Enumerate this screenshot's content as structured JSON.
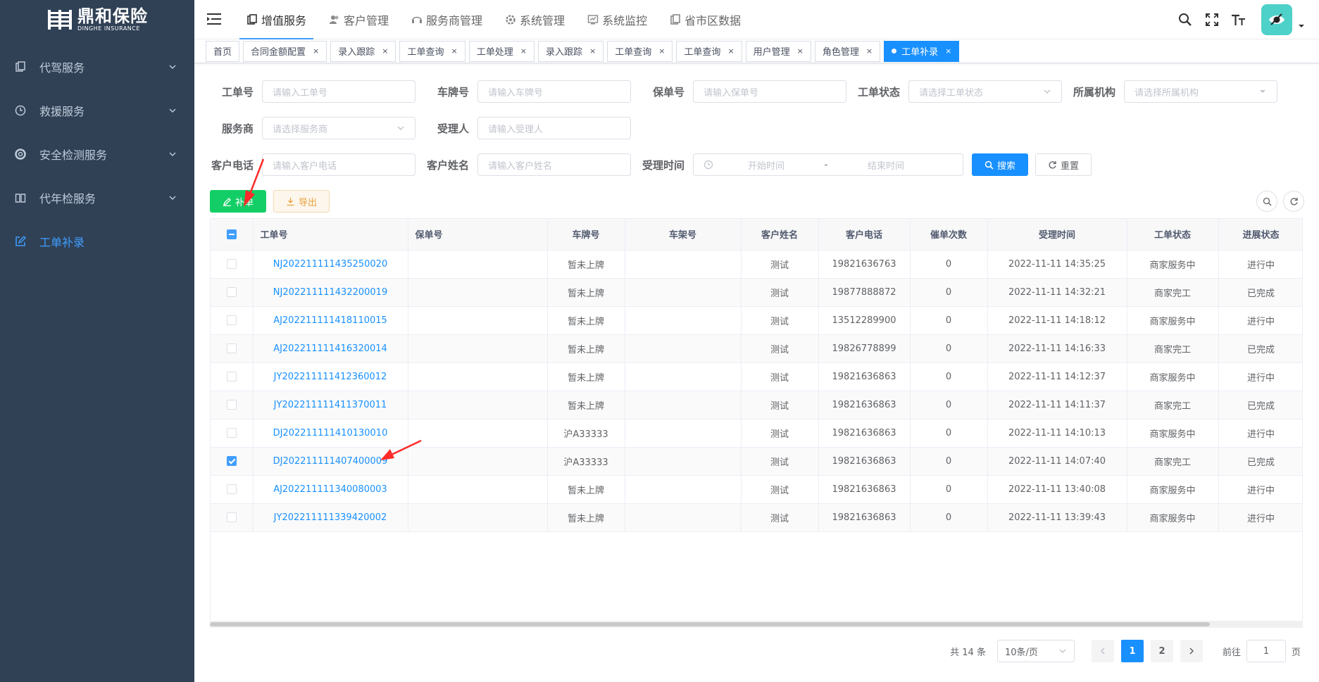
{
  "sidebar": {
    "logo_cn": "鼎和保险",
    "logo_en": "DINGHE INSURANCE",
    "items": [
      {
        "label": "代驾服务"
      },
      {
        "label": "救援服务"
      },
      {
        "label": "安全检测服务"
      },
      {
        "label": "代年检服务"
      },
      {
        "label": "工单补录"
      }
    ]
  },
  "topnav": {
    "items": [
      {
        "label": "增值服务"
      },
      {
        "label": "客户管理"
      },
      {
        "label": "服务商管理"
      },
      {
        "label": "系统管理"
      },
      {
        "label": "系统监控"
      },
      {
        "label": "省市区数据"
      }
    ]
  },
  "tags": [
    {
      "label": "首页"
    },
    {
      "label": "合同金额配置"
    },
    {
      "label": "录入跟踪"
    },
    {
      "label": "工单查询"
    },
    {
      "label": "工单处理"
    },
    {
      "label": "录入跟踪"
    },
    {
      "label": "工单查询"
    },
    {
      "label": "工单查询"
    },
    {
      "label": "用户管理"
    },
    {
      "label": "角色管理"
    },
    {
      "label": "工单补录"
    }
  ],
  "tag_close": "×",
  "form": {
    "order_no": {
      "label": "工单号",
      "placeholder": "请输入工单号"
    },
    "plate": {
      "label": "车牌号",
      "placeholder": "请输入车牌号"
    },
    "policy": {
      "label": "保单号",
      "placeholder": "请输入保单号"
    },
    "status": {
      "label": "工单状态",
      "placeholder": "请选择工单状态"
    },
    "org": {
      "label": "所属机构",
      "placeholder": "请选择所属机构"
    },
    "provider": {
      "label": "服务商",
      "placeholder": "请选择服务商"
    },
    "acceptor": {
      "label": "受理人",
      "placeholder": "请输入受理人"
    },
    "phone": {
      "label": "客户电话",
      "placeholder": "请输入客户电话"
    },
    "name": {
      "label": "客户姓名",
      "placeholder": "请输入客户姓名"
    },
    "time": {
      "label": "受理时间",
      "start": "开始时间",
      "sep": "-",
      "end": "结束时间"
    },
    "search_btn": "搜索",
    "reset_btn": "重置"
  },
  "toolbar": {
    "add_btn": "补单",
    "export_btn": "导出"
  },
  "table": {
    "headers": [
      "工单号",
      "保单号",
      "车牌号",
      "车架号",
      "客户姓名",
      "客户电话",
      "催单次数",
      "受理时间",
      "工单状态",
      "进展状态"
    ],
    "rows": [
      {
        "order": "NJ202211111435250020",
        "policy": "",
        "plate": "暂未上牌",
        "vin": "",
        "name": "测试",
        "phone": "19821636763",
        "urge": "0",
        "time": "2022-11-11 14:35:25",
        "status": "商家服务中",
        "progress": "进行中",
        "checked": false
      },
      {
        "order": "NJ202211111432200019",
        "policy": "",
        "plate": "暂未上牌",
        "vin": "",
        "name": "测试",
        "phone": "19877888872",
        "urge": "0",
        "time": "2022-11-11 14:32:21",
        "status": "商家完工",
        "progress": "已完成",
        "checked": false
      },
      {
        "order": "AJ202211111418110015",
        "policy": "",
        "plate": "暂未上牌",
        "vin": "",
        "name": "测试",
        "phone": "13512289900",
        "urge": "0",
        "time": "2022-11-11 14:18:12",
        "status": "商家服务中",
        "progress": "进行中",
        "checked": false
      },
      {
        "order": "AJ202211111416320014",
        "policy": "",
        "plate": "暂未上牌",
        "vin": "",
        "name": "测试",
        "phone": "19826778899",
        "urge": "0",
        "time": "2022-11-11 14:16:33",
        "status": "商家完工",
        "progress": "已完成",
        "checked": false
      },
      {
        "order": "JY202211111412360012",
        "policy": "",
        "plate": "暂未上牌",
        "vin": "",
        "name": "测试",
        "phone": "19821636863",
        "urge": "0",
        "time": "2022-11-11 14:12:37",
        "status": "商家服务中",
        "progress": "进行中",
        "checked": false
      },
      {
        "order": "JY202211111411370011",
        "policy": "",
        "plate": "暂未上牌",
        "vin": "",
        "name": "测试",
        "phone": "19821636863",
        "urge": "0",
        "time": "2022-11-11 14:11:37",
        "status": "商家完工",
        "progress": "已完成",
        "checked": false
      },
      {
        "order": "DJ202211111410130010",
        "policy": "",
        "plate": "沪A33333",
        "vin": "",
        "name": "测试",
        "phone": "19821636863",
        "urge": "0",
        "time": "2022-11-11 14:10:13",
        "status": "商家服务中",
        "progress": "进行中",
        "checked": false
      },
      {
        "order": "DJ202211111407400009",
        "policy": "",
        "plate": "沪A33333",
        "vin": "",
        "name": "测试",
        "phone": "19821636863",
        "urge": "0",
        "time": "2022-11-11 14:07:40",
        "status": "商家完工",
        "progress": "已完成",
        "checked": true
      },
      {
        "order": "AJ202211111340080003",
        "policy": "",
        "plate": "暂未上牌",
        "vin": "",
        "name": "测试",
        "phone": "19821636863",
        "urge": "0",
        "time": "2022-11-11 13:40:08",
        "status": "商家服务中",
        "progress": "进行中",
        "checked": false
      },
      {
        "order": "JY202211111339420002",
        "policy": "",
        "plate": "暂未上牌",
        "vin": "",
        "name": "测试",
        "phone": "19821636863",
        "urge": "0",
        "time": "2022-11-11 13:39:43",
        "status": "商家服务中",
        "progress": "进行中",
        "checked": false
      }
    ]
  },
  "pagination": {
    "total": "共 14 条",
    "size": "10条/页",
    "pages": [
      "1",
      "2"
    ],
    "goto_label": "前往",
    "goto_value": "1",
    "page_suffix": "页"
  },
  "colors": {
    "sidebar_bg": "#304156",
    "primary": "#1890ff",
    "success": "#13ce66",
    "annotation": "#ff2a2a"
  }
}
